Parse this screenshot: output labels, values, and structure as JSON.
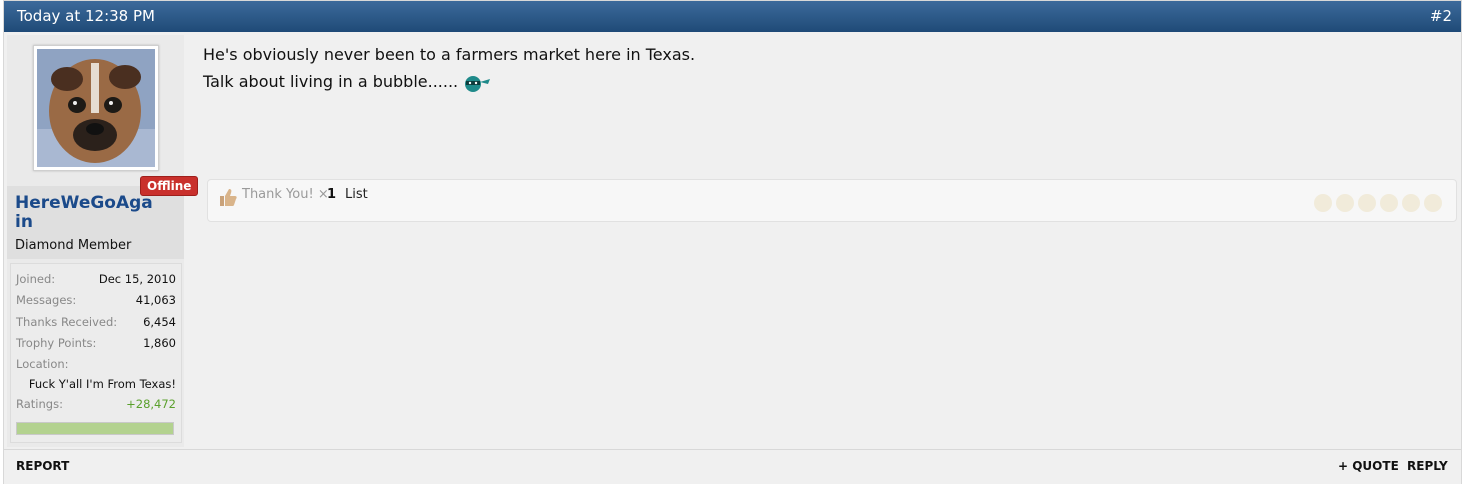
{
  "header": {
    "date": "Today at 12:38 PM",
    "post_number": "#2"
  },
  "user": {
    "name": "HereWeGoAgain",
    "title": "Diamond Member",
    "status": "Offline",
    "stats": {
      "joined_label": "Joined:",
      "joined": "Dec 15, 2010",
      "messages_label": "Messages:",
      "messages": "41,063",
      "thanks_label": "Thanks Received:",
      "thanks": "6,454",
      "trophy_label": "Trophy Points:",
      "trophy": "1,860",
      "location_label": "Location:",
      "location": "Fuck Y'all I'm From Texas!",
      "ratings_label": "Ratings:",
      "ratings": "+28,472"
    },
    "rating_level": 1.0,
    "avatar_icon": "dog-avatar",
    "colors": {
      "name": "#1b4a8a",
      "positive": "#5aa02c",
      "offline": "#c9302c"
    }
  },
  "message": {
    "line1": "He's obviously never been to a farmers market here in Texas.",
    "line2": "Talk about living in a bubble......",
    "emoji": "ninja-emoji"
  },
  "likes": {
    "label": "Thank You!",
    "times": "×",
    "count": "1",
    "list": "List"
  },
  "footer": {
    "report": "REPORT",
    "quote": "+ QUOTE",
    "reply": "REPLY"
  }
}
